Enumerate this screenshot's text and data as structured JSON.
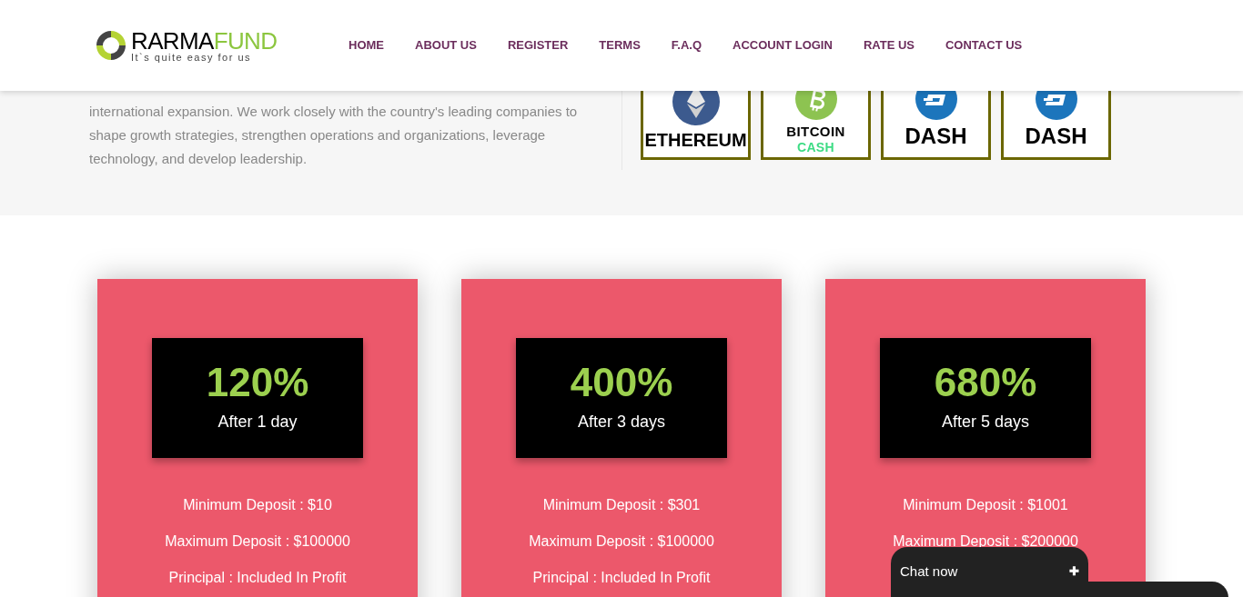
{
  "header": {
    "logo": {
      "name_dark": "RARMA",
      "name_green": "FUND",
      "tagline": "It`s quite easy for us"
    },
    "nav": [
      {
        "label": "HOME"
      },
      {
        "label": "ABOUT US"
      },
      {
        "label": "REGISTER"
      },
      {
        "label": "TERMS"
      },
      {
        "label": "F.A.Q"
      },
      {
        "label": "ACCOUNT LOGIN"
      },
      {
        "label": "RATE US"
      },
      {
        "label": "CONTACT US"
      }
    ]
  },
  "about": {
    "text": "international expansion. We work closely with the country's leading companies to shape growth strategies, strengthen operations and organizations, leverage technology, and develop leadership."
  },
  "coins": [
    {
      "kind": "ethereum",
      "label": "ETHEREUM"
    },
    {
      "kind": "bitcoin_cash",
      "label": "BITCOIN",
      "sublabel": "CASH"
    },
    {
      "kind": "dash",
      "label": "DASH"
    },
    {
      "kind": "dash",
      "label": "DASH"
    }
  ],
  "plans": [
    {
      "percent": "120%",
      "period": "After 1 day",
      "lines": [
        "Minimum Deposit : $10",
        "Maximum Deposit : $100000",
        "Principal : Included In Profit"
      ]
    },
    {
      "percent": "400%",
      "period": "After 3 days",
      "lines": [
        "Minimum Deposit : $301",
        "Maximum Deposit : $100000",
        "Principal : Included In Profit"
      ]
    },
    {
      "percent": "680%",
      "period": "After 5 days",
      "lines": [
        "Minimum Deposit : $1001",
        "Maximum Deposit : $200000"
      ]
    }
  ],
  "chat": {
    "label": "Chat now",
    "toggle": "✚"
  }
}
